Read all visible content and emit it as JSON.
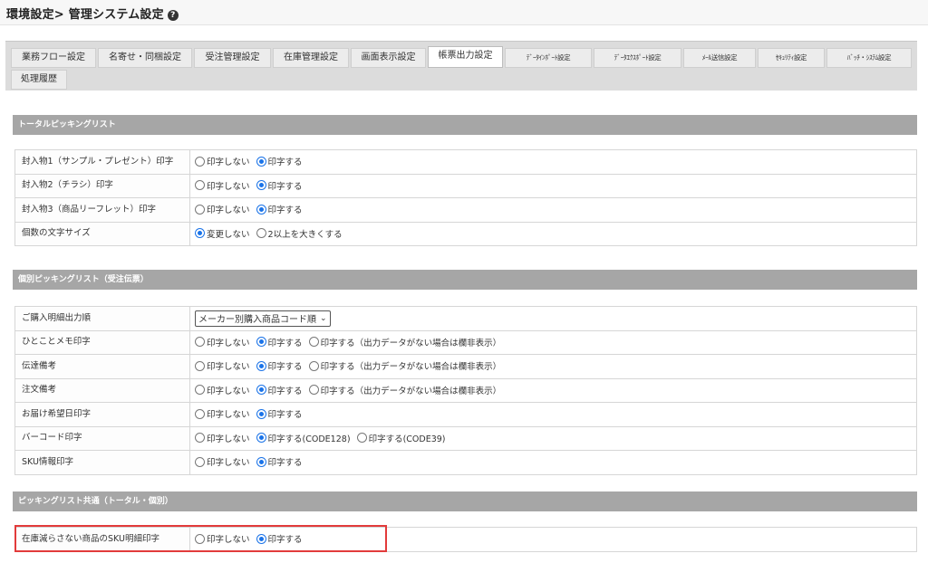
{
  "header": {
    "title": "環境設定> 管理システム設定"
  },
  "tabs": [
    {
      "label": "業務フロー設定",
      "active": false
    },
    {
      "label": "名寄せ・同梱設定",
      "active": false
    },
    {
      "label": "受注管理設定",
      "active": false
    },
    {
      "label": "在庫管理設定",
      "active": false
    },
    {
      "label": "画面表示設定",
      "active": false
    },
    {
      "label": "帳票出力設定",
      "active": true
    },
    {
      "label": "ﾃﾞｰﾀｲﾝﾎﾟｰﾄ設定",
      "active": false
    },
    {
      "label": "ﾃﾞｰﾀｴｸｽﾎﾟｰﾄ設定",
      "active": false
    },
    {
      "label": "ﾒｰﾙ送信設定",
      "active": false
    },
    {
      "label": "ｾｷｭﾘﾃｨ設定",
      "active": false
    },
    {
      "label": "ﾊﾞｯﾁ・ｼｽﾃﾑ設定",
      "active": false
    },
    {
      "label": "処理履歴",
      "active": false
    }
  ],
  "sections": [
    {
      "title": "トータルピッキングリスト",
      "rows": [
        {
          "label": "封入物1（サンプル・プレゼント）印字",
          "options": [
            "印字しない",
            "印字する"
          ],
          "selected": 1
        },
        {
          "label": "封入物2（チラシ）印字",
          "options": [
            "印字しない",
            "印字する"
          ],
          "selected": 1
        },
        {
          "label": "封入物3（商品リーフレット）印字",
          "options": [
            "印字しない",
            "印字する"
          ],
          "selected": 1
        },
        {
          "label": "個数の文字サイズ",
          "options": [
            "変更しない",
            "2以上を大きくする"
          ],
          "selected": 0
        }
      ]
    },
    {
      "title": "個別ピッキングリスト（受注伝票）",
      "rows": [
        {
          "label": "ご購入明細出力順",
          "select": "メーカー別購入商品コード順"
        },
        {
          "label": "ひとことメモ印字",
          "options": [
            "印字しない",
            "印字する",
            "印字する（出力データがない場合は欄非表示）"
          ],
          "selected": 1
        },
        {
          "label": "伝達備考",
          "options": [
            "印字しない",
            "印字する",
            "印字する（出力データがない場合は欄非表示）"
          ],
          "selected": 1
        },
        {
          "label": "注文備考",
          "options": [
            "印字しない",
            "印字する",
            "印字する（出力データがない場合は欄非表示）"
          ],
          "selected": 1
        },
        {
          "label": "お届け希望日印字",
          "options": [
            "印字しない",
            "印字する"
          ],
          "selected": 1
        },
        {
          "label": "バーコード印字",
          "options": [
            "印字しない",
            "印字する(CODE128)",
            "印字する(CODE39)"
          ],
          "selected": 1
        },
        {
          "label": "SKU情報印字",
          "options": [
            "印字しない",
            "印字する"
          ],
          "selected": 1
        }
      ]
    },
    {
      "title": "ピッキングリスト共通（トータル・個別）",
      "rows": [
        {
          "label": "在庫減らさない商品のSKU明細印字",
          "options": [
            "印字しない",
            "印字する"
          ],
          "selected": 1
        }
      ]
    }
  ],
  "colors": {
    "accent": "#1a73e8",
    "section_bar": "#a6a6a6",
    "highlight": "#e23b3b"
  }
}
